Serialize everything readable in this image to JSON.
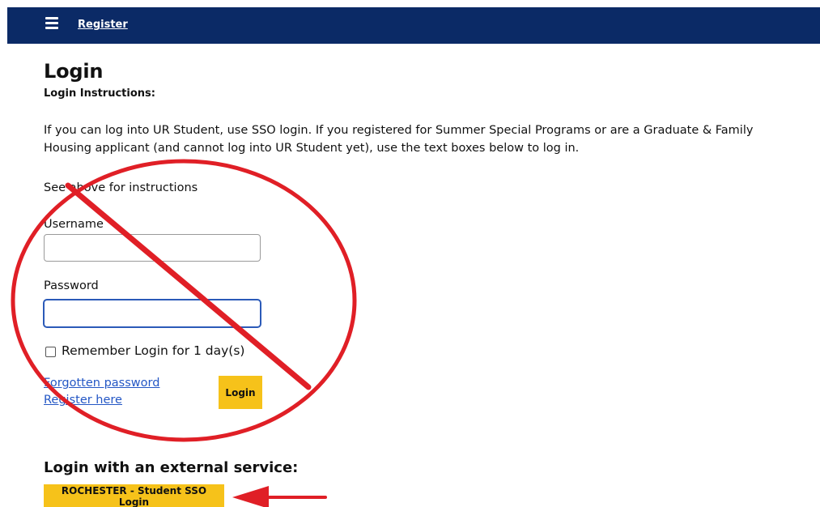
{
  "nav": {
    "register_label": "Register"
  },
  "page": {
    "title": "Login",
    "instructions_heading": "Login Instructions:",
    "intro_text": "If you can log into UR Student, use SSO login. If you registered for Summer Special Programs or are a Graduate & Family Housing applicant (and cannot log into UR Student yet), use the text boxes below to log in.",
    "hint_text": "See above for instructions"
  },
  "form": {
    "username_label": "Username",
    "username_value": "",
    "password_label": "Password",
    "password_value": "",
    "remember_label": "Remember Login for 1 day(s)",
    "remember_checked": false,
    "forgot_link": "Forgotten password",
    "register_link": "Register here",
    "login_button": "Login"
  },
  "external": {
    "heading": "Login with an external service:",
    "sso_button": "ROCHESTER - Student SSO Login"
  },
  "colors": {
    "header_bg": "#0b2a66",
    "accent_yellow": "#f6c21a",
    "link_blue": "#2457c5",
    "annotation_red": "#e01f26"
  }
}
